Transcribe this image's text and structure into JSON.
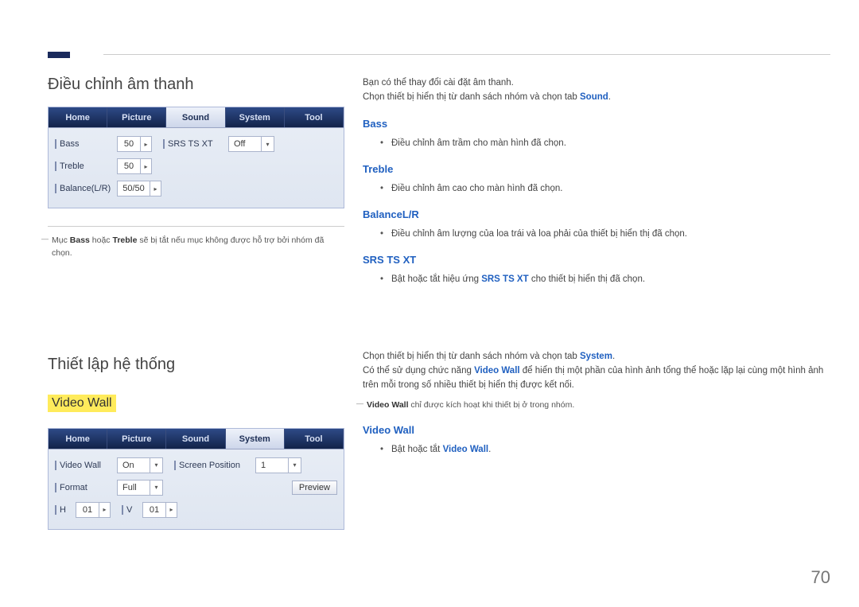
{
  "section1": {
    "title": "Điều chỉnh âm thanh",
    "tabs": {
      "home": "Home",
      "picture": "Picture",
      "sound": "Sound",
      "system": "System",
      "tool": "Tool"
    },
    "fields": {
      "bass": {
        "label": "Bass",
        "value": "50"
      },
      "treble": {
        "label": "Treble",
        "value": "50"
      },
      "balance": {
        "label": "Balance(L/R)",
        "value": "50/50"
      },
      "srs": {
        "label": "SRS TS XT",
        "value": "Off"
      }
    },
    "footnote_pre": "Mục ",
    "footnote_b1": "Bass",
    "footnote_mid": " hoặc ",
    "footnote_b2": "Treble",
    "footnote_post": " sẽ bị tắt nếu mục không được hỗ trợ bởi nhóm đã chọn."
  },
  "right1": {
    "l1": "Bạn có thể thay đổi cài đặt âm thanh.",
    "l2a": "Chọn thiết bị hiển thị từ danh sách nhóm và chọn tab ",
    "l2b": "Sound",
    "l2c": ".",
    "bass": {
      "h": "Bass",
      "li": "Điều chỉnh âm trầm cho màn hình đã chọn."
    },
    "treble": {
      "h": "Treble",
      "li": "Điều chỉnh âm cao cho màn hình đã chọn."
    },
    "balance": {
      "h": "BalanceL/R",
      "li": "Điều chỉnh âm lượng của loa trái và loa phải của thiết bị hiển thị đã chọn."
    },
    "srs": {
      "h": "SRS TS XT",
      "liA": "Bật hoặc tắt hiệu ứng ",
      "liB": "SRS TS XT",
      "liC": " cho thiết bị hiển thị đã chọn."
    }
  },
  "section2": {
    "title": "Thiết lập hệ thống",
    "highlight": "Video Wall",
    "tabs": {
      "home": "Home",
      "picture": "Picture",
      "sound": "Sound",
      "system": "System",
      "tool": "Tool"
    },
    "fields": {
      "vw": {
        "label": "Video Wall",
        "value": "On"
      },
      "fmt": {
        "label": "Format",
        "value": "Full"
      },
      "sp": {
        "label": "Screen Position",
        "value": "1"
      },
      "preview": "Preview",
      "h": {
        "label": "H",
        "value": "01"
      },
      "v": {
        "label": "V",
        "value": "01"
      }
    }
  },
  "right2": {
    "l1a": "Chọn thiết bị hiển thị từ danh sách nhóm và chọn tab ",
    "l1b": "System",
    "l1c": ".",
    "l2a": "Có thể sử dụng chức năng ",
    "l2b": "Video Wall",
    "l2c": " để hiển thị một phần của hình ảnh tổng thể hoặc lặp lại cùng một hình ảnh trên mỗi trong số nhiều thiết bị hiển thị được kết nối.",
    "fnA": "Video Wall",
    "fnB": " chỉ được kích hoạt khi thiết bị ở trong nhóm.",
    "vw": {
      "h": "Video Wall",
      "liA": "Bật hoặc tắt ",
      "liB": "Video Wall",
      "liC": "."
    }
  },
  "page": "70"
}
